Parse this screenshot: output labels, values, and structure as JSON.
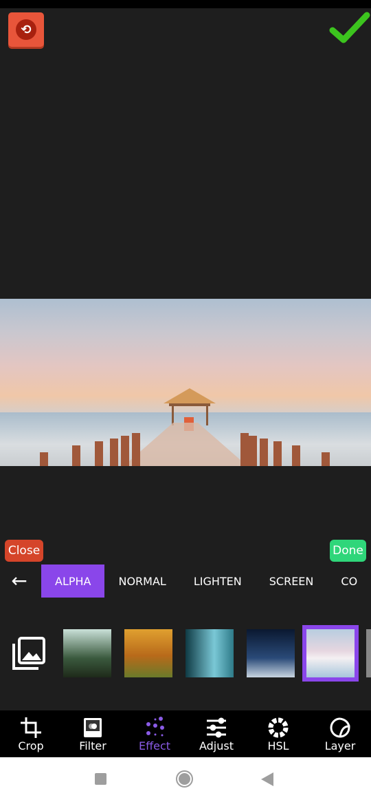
{
  "toolbar": {
    "undo_icon": "undo-icon",
    "confirm_icon": "checkmark-icon",
    "confirm_color": "#3cc41e"
  },
  "actions": {
    "close_label": "Close",
    "done_label": "Done"
  },
  "blend_modes": {
    "items": [
      "ALPHA",
      "NORMAL",
      "LIGHTEN",
      "SCREEN",
      "CO"
    ],
    "selected": "ALPHA"
  },
  "bottom_nav": {
    "items": [
      {
        "label": "Crop",
        "icon": "crop-icon"
      },
      {
        "label": "Filter",
        "icon": "filter-icon"
      },
      {
        "label": "Effect",
        "icon": "effect-icon"
      },
      {
        "label": "Adjust",
        "icon": "sliders-icon"
      },
      {
        "label": "HSL",
        "icon": "hsl-icon"
      },
      {
        "label": "Layer",
        "icon": "sticker-icon"
      }
    ],
    "active": "Effect"
  },
  "colors": {
    "accent": "#8a46ea",
    "close": "#d5452a",
    "done": "#2fd67a",
    "undo": "#e8553a"
  }
}
